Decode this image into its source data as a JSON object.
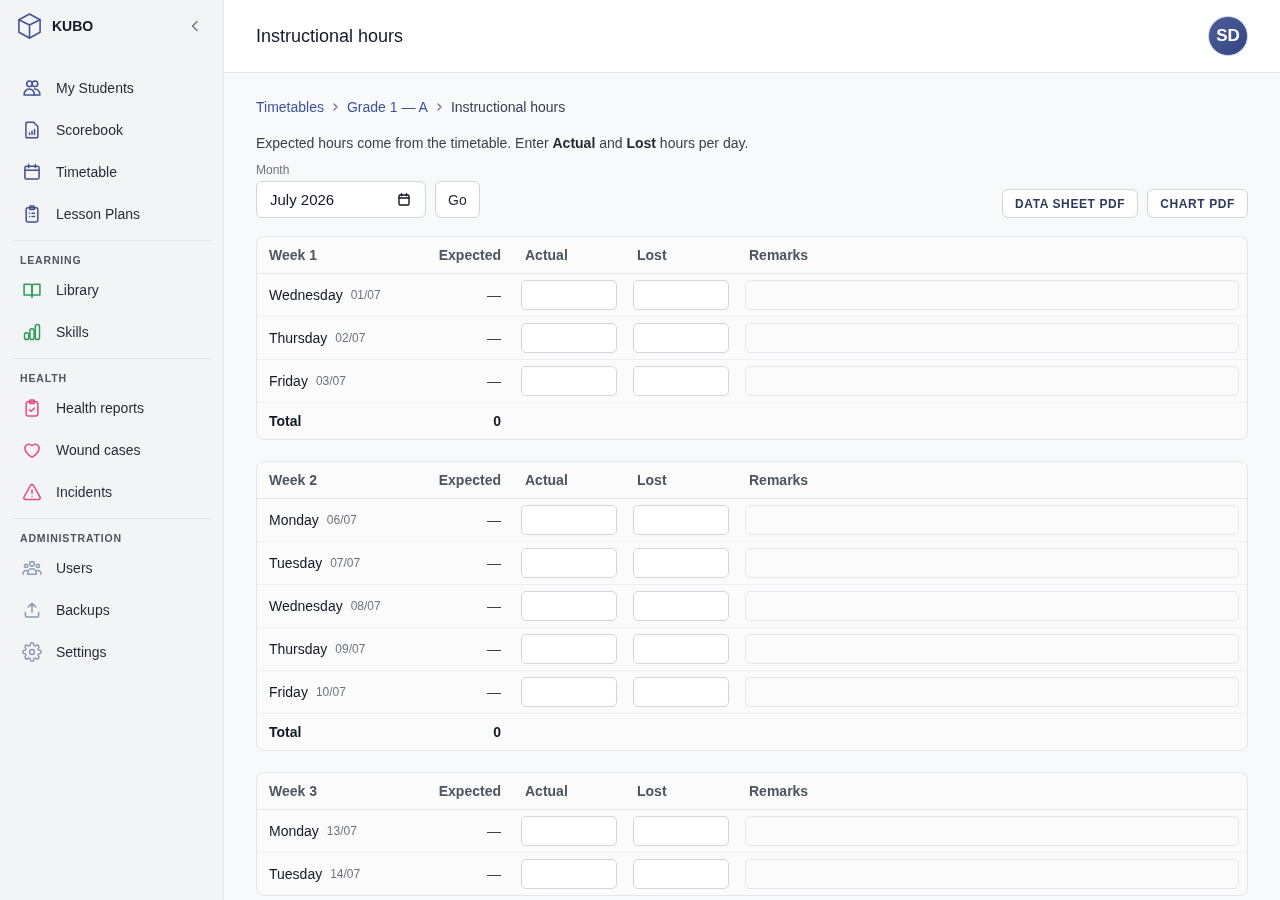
{
  "sidebar": {
    "brand": "KUBO",
    "groups": [
      {
        "color": "#3f5191",
        "items": [
          {
            "label": "My Students",
            "selected": false
          },
          {
            "label": "Scorebook",
            "selected": false
          },
          {
            "label": "Timetable",
            "selected": false
          },
          {
            "label": "Lesson Plans",
            "selected": false
          }
        ]
      },
      {
        "heading": "LEARNING",
        "color": "#2e9a57",
        "items": [
          {
            "label": "Library",
            "selected": false
          },
          {
            "label": "Skills",
            "selected": false
          }
        ]
      },
      {
        "heading": "HEALTH",
        "color": "#e64980",
        "items": [
          {
            "label": "Health reports",
            "selected": false
          },
          {
            "label": "Wound cases",
            "selected": false
          },
          {
            "label": "Incidents",
            "selected": false
          }
        ]
      },
      {
        "heading": "ADMINISTRATION",
        "color": "#8a9ab8",
        "items": [
          {
            "label": "Users",
            "selected": false
          },
          {
            "label": "Backups",
            "selected": false
          },
          {
            "label": "Settings",
            "selected": false
          }
        ]
      }
    ]
  },
  "header": {
    "title": "Instructional hours",
    "avatar_initials": "SD"
  },
  "breadcrumb": [
    {
      "label": "Timetables",
      "kind": "link"
    },
    {
      "label": "Grade 1 — A",
      "kind": "link"
    },
    {
      "label": "Instructional hours",
      "kind": "current"
    }
  ],
  "description": "Expected hours come from the timetable. Enter **Actual** and **Lost** hours per day.",
  "month": {
    "label": "Month",
    "value": "July 2026"
  },
  "go_button": "Go",
  "export_buttons": [
    "DATA SHEET PDF",
    "CHART PDF"
  ],
  "weeks": [
    {
      "title": "Week 1",
      "columns": [
        {
          "label": "Expected",
          "kind": "readout"
        },
        {
          "label": "Actual",
          "kind": "entry"
        },
        {
          "label": "Lost",
          "kind": "entry"
        },
        {
          "label": "Remarks",
          "kind": "note"
        }
      ],
      "days": [
        {
          "day": "Wednesday",
          "date": "01/07",
          "expected": "—"
        },
        {
          "day": "Thursday",
          "date": "02/07",
          "expected": "—"
        },
        {
          "day": "Friday",
          "date": "03/07",
          "expected": "—"
        }
      ],
      "total": {
        "label": "Total",
        "expected": "0"
      }
    },
    {
      "title": "Week 2",
      "columns": [
        {
          "label": "Expected",
          "kind": "readout"
        },
        {
          "label": "Actual",
          "kind": "entry"
        },
        {
          "label": "Lost",
          "kind": "entry"
        },
        {
          "label": "Remarks",
          "kind": "note"
        }
      ],
      "days": [
        {
          "day": "Monday",
          "date": "06/07",
          "expected": "—"
        },
        {
          "day": "Tuesday",
          "date": "07/07",
          "expected": "—"
        },
        {
          "day": "Wednesday",
          "date": "08/07",
          "expected": "—"
        },
        {
          "day": "Thursday",
          "date": "09/07",
          "expected": "—"
        },
        {
          "day": "Friday",
          "date": "10/07",
          "expected": "—"
        }
      ],
      "total": {
        "label": "Total",
        "expected": "0"
      }
    },
    {
      "title": "Week 3",
      "columns": [
        {
          "label": "Expected",
          "kind": "readout"
        },
        {
          "label": "Actual",
          "kind": "entry"
        },
        {
          "label": "Lost",
          "kind": "entry"
        },
        {
          "label": "Remarks",
          "kind": "note"
        }
      ],
      "days": [
        {
          "day": "Monday",
          "date": "13/07",
          "expected": "—"
        },
        {
          "day": "Tuesday",
          "date": "14/07",
          "expected": "—"
        }
      ]
    }
  ]
}
